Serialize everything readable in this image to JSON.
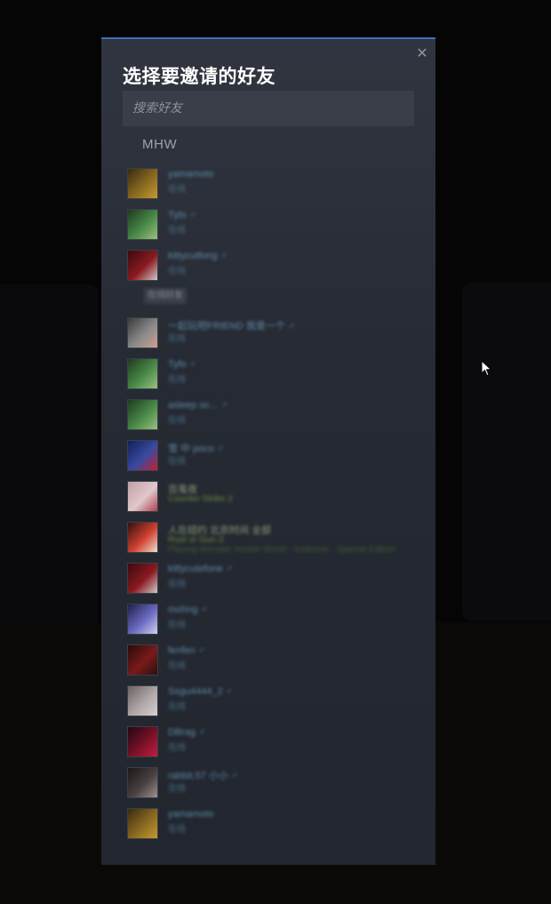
{
  "dialog": {
    "title": "选择要邀请的好友",
    "close_label": "✕",
    "search": {
      "placeholder": "搜索好友",
      "value": ""
    },
    "group_label": "MHW"
  },
  "friends_top": [
    {
      "name": "yamamoto",
      "status": "在线",
      "avatar_colors": [
        "#3a2a10",
        "#8a6a20",
        "#c49a30"
      ],
      "state": "online"
    },
    {
      "name": "Tyto ♂",
      "status": "在线",
      "avatar_colors": [
        "#1e3a20",
        "#4a8a48",
        "#9ac080"
      ],
      "state": "online"
    },
    {
      "name": "kittycutfong ♂",
      "status": "在线",
      "avatar_colors": [
        "#3a0a10",
        "#8a1a20",
        "#d0c8c8"
      ],
      "state": "online"
    }
  ],
  "subgroup_label": "在线好友",
  "friends_main": [
    {
      "name": "一起玩吧FRIEND 我是一个 ♂",
      "status": "在线",
      "avatar_colors": [
        "#3a3a3a",
        "#8a8a8a",
        "#d0a090"
      ],
      "state": "online"
    },
    {
      "name": "Tyfo ♂",
      "status": "在线",
      "avatar_colors": [
        "#1e3a20",
        "#4a8a48",
        "#9ac080"
      ],
      "state": "online"
    },
    {
      "name": "asleep oc... ♂",
      "status": "在线",
      "avatar_colors": [
        "#1e3a20",
        "#4a8a48",
        "#9ac080"
      ],
      "state": "online"
    },
    {
      "name": "雪 中 poco ♂",
      "status": "在线",
      "avatar_colors": [
        "#10205a",
        "#3a4aa0",
        "#c02030"
      ],
      "state": "online"
    },
    {
      "name": "百鬼夜",
      "status": "Counter-Strike 2",
      "avatar_colors": [
        "#c0a0a8",
        "#e0c8cc",
        "#b04050"
      ],
      "state": "ingame"
    },
    {
      "name": "人在纽约 北京时间 全部",
      "status": "Rust or Gun 3",
      "sub": "Playing Monster Hunter World · Iceborne · Special Edition",
      "avatar_colors": [
        "#301010",
        "#d04030",
        "#f0e0d0"
      ],
      "state": "ingame"
    },
    {
      "name": "kittycutefone ♂",
      "status": "在线",
      "avatar_colors": [
        "#3a0a10",
        "#8a1a20",
        "#d0c8c8"
      ],
      "state": "online"
    },
    {
      "name": "mohng ♂",
      "status": "在线",
      "avatar_colors": [
        "#20204a",
        "#6a6ac0",
        "#d0d0f0"
      ],
      "state": "online"
    },
    {
      "name": "fenfen ♂",
      "status": "在线",
      "avatar_colors": [
        "#2a0a0a",
        "#7a1a1a",
        "#2a1010"
      ],
      "state": "online"
    },
    {
      "name": "Ssgu4444_2 ♂",
      "status": "在线",
      "avatar_colors": [
        "#6a6060",
        "#b0a8a8",
        "#d8d0d0"
      ],
      "state": "online"
    },
    {
      "name": "DBrag ♂",
      "status": "在线",
      "avatar_colors": [
        "#200a10",
        "#7a1028",
        "#c02040"
      ],
      "state": "online"
    },
    {
      "name": "rabbit.57 小小 ♂",
      "status": "在线",
      "avatar_colors": [
        "#1a1818",
        "#4a4040",
        "#a09090"
      ],
      "state": "online"
    },
    {
      "name": "yamamoto",
      "status": "在线",
      "avatar_colors": [
        "#3a2a10",
        "#8a6a20",
        "#c49a30"
      ],
      "state": "online"
    }
  ]
}
